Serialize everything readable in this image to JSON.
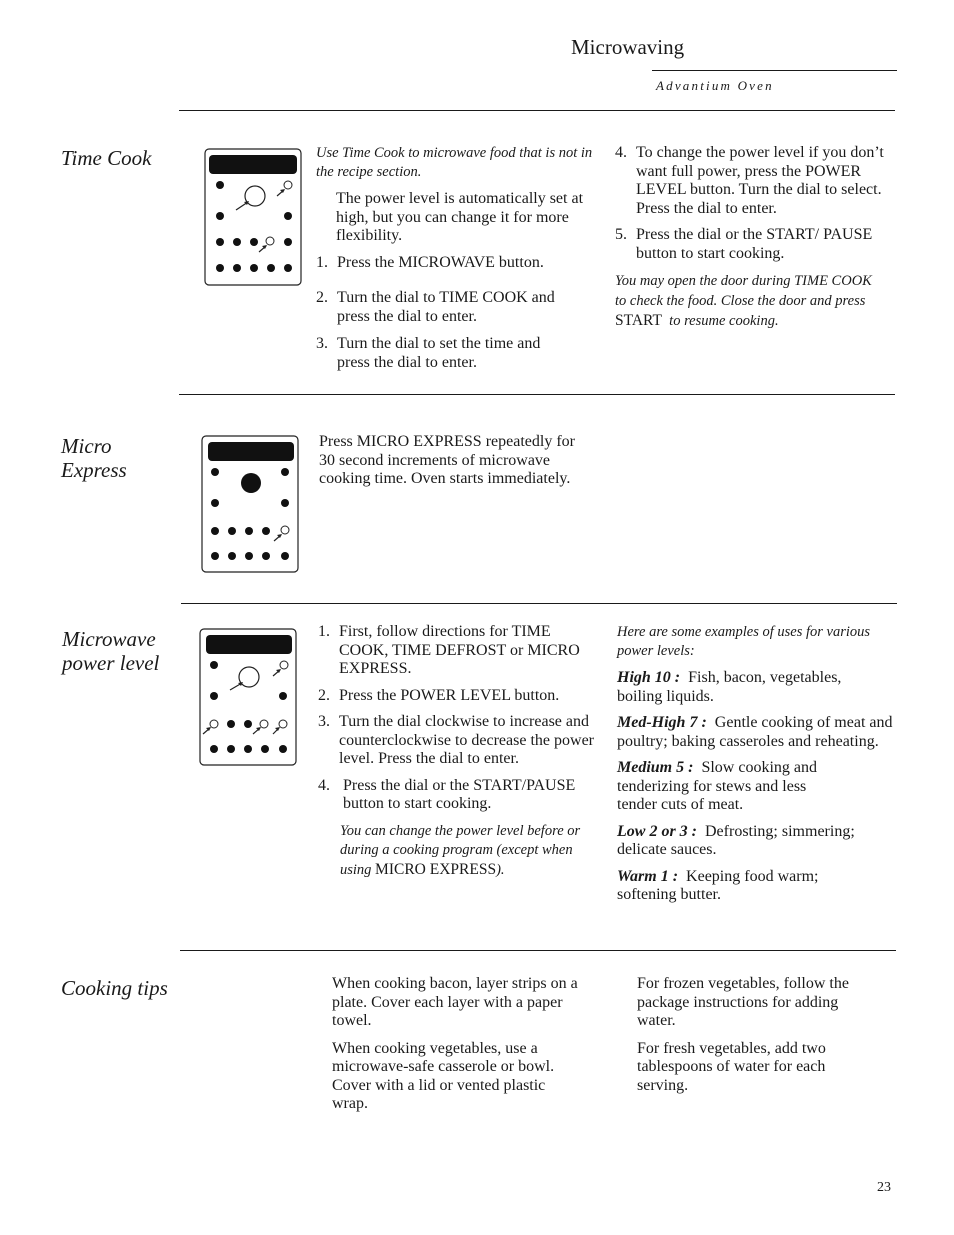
{
  "header": {
    "title": "Microwaving",
    "subtitle": "Advantium Oven"
  },
  "sections": {
    "time_cook": {
      "title": "Time Cook",
      "intro_italic": "Use Time Cook to microwave food that is not in the recipe section.",
      "intro": "The power level is automatically set at high, but you can change it for more flexibility.",
      "steps": [
        {
          "num": "1.",
          "text": "Press the MICROWAVE  button."
        },
        {
          "num": "2.",
          "text": "Turn the dial to TIME COOK and press the dial to enter."
        },
        {
          "num": "3.",
          "text": "Turn the dial to set the time and press the dial to enter."
        },
        {
          "num": "4.",
          "text": "To change the power level if you don’t want full power, press the POWER LEVEL button. Turn the dial to select. Press the dial to enter."
        },
        {
          "num": "5.",
          "text": "Press the dial or the START/ PAUSE button to start cooking."
        }
      ],
      "note_italic_a": "You may open the door during TIME COOK to check the food. Close the door and press",
      "note_roman": "START",
      "note_italic_b": "to resume cooking."
    },
    "micro_express": {
      "title_line1": "Micro",
      "title_line2": "Express",
      "text": "Press MICRO EXPRESS repeatedly for 30 second increments of microwave cooking time. Oven starts immediately."
    },
    "power_level": {
      "title_line1": "Microwave",
      "title_line2": "power level",
      "steps": [
        {
          "num": "1.",
          "text": "First, follow directions for TIME COOK, TIME DEFROST or MICRO EXPRESS."
        },
        {
          "num": "2.",
          "text": "Press the POWER LEVEL button."
        },
        {
          "num": "3.",
          "text": "Turn the dial clockwise to increase and counterclockwise to decrease the power level. Press the dial to enter."
        },
        {
          "num": "4.",
          "text": "Press the dial or the START/PAUSE button to start cooking."
        }
      ],
      "note_italic": "You can change the power level before or during a cooking program (except when using",
      "note_roman": "MICRO EXPRESS",
      "note_end": ").",
      "examples_intro": "Here are some examples of uses for various power levels:",
      "examples": [
        {
          "label": "High 10 :",
          "text": "Fish, bacon, vegetables, boiling liquids."
        },
        {
          "label": "Med-High 7 :",
          "text": "Gentle cooking of meat and poultry; baking casseroles and reheating."
        },
        {
          "label": "Medium 5 :",
          "text": "Slow cooking and tenderizing for stews and less tender cuts of meat."
        },
        {
          "label": "Low 2 or 3 :",
          "text": "Defrosting; simmering; delicate sauces."
        },
        {
          "label": "Warm 1 :",
          "text": "Keeping food warm; softening butter."
        }
      ]
    },
    "cooking_tips": {
      "title": "Cooking tips",
      "left": [
        "When cooking bacon, layer strips on a plate. Cover each layer with a paper towel.",
        "When cooking vegetables, use a microwave-safe casserole or bowl. Cover with a lid or vented plastic wrap."
      ],
      "right": [
        "For frozen vegetables, follow the package instructions for adding water.",
        "For fresh vegetables, add two tablespoons of water for each serving."
      ]
    }
  },
  "page_number": "23"
}
